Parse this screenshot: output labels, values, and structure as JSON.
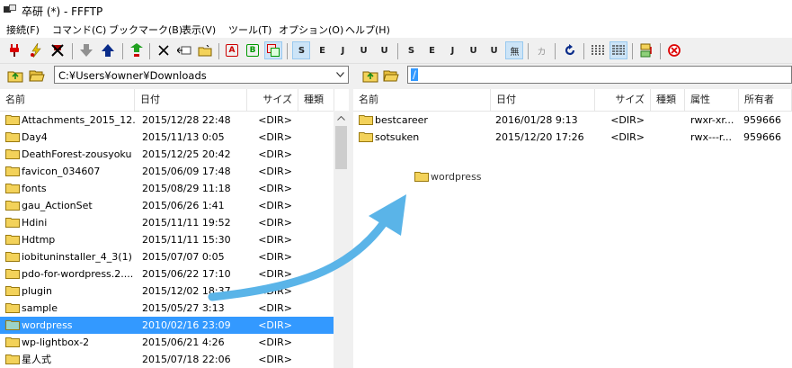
{
  "window": {
    "title": "卒研 (*) - FFFTP"
  },
  "menu": [
    "接続(F)",
    "コマンド(C)",
    "ブックマーク(B)",
    "表示(V)",
    "ツール(T)",
    "オプション(O)",
    "ヘルプ(H)"
  ],
  "toolbar": {
    "ascii_label": "A",
    "binary_label": "B",
    "sjis_label": "S",
    "euc_label": "E",
    "jis_label": "J",
    "utf8_label": "U",
    "utf8bom_label": "U",
    "none_label": "無",
    "kana_label": "カ"
  },
  "local": {
    "path": "C:¥Users¥owner¥Downloads",
    "columns": {
      "name": "名前",
      "date": "日付",
      "size": "サイズ",
      "type": "種類"
    },
    "files": [
      {
        "name": "Attachments_2015_12...",
        "date": "2015/12/28 22:48",
        "size": "<DIR>",
        "selected": false
      },
      {
        "name": "Day4",
        "date": "2015/11/13 0:05",
        "size": "<DIR>",
        "selected": false
      },
      {
        "name": "DeathForest-zousyoku",
        "date": "2015/12/25 20:42",
        "size": "<DIR>",
        "selected": false
      },
      {
        "name": "favicon_034607",
        "date": "2015/06/09 17:48",
        "size": "<DIR>",
        "selected": false
      },
      {
        "name": "fonts",
        "date": "2015/08/29 11:18",
        "size": "<DIR>",
        "selected": false
      },
      {
        "name": "gau_ActionSet",
        "date": "2015/06/26 1:41",
        "size": "<DIR>",
        "selected": false
      },
      {
        "name": "Hdini",
        "date": "2015/11/11 19:52",
        "size": "<DIR>",
        "selected": false
      },
      {
        "name": "Hdtmp",
        "date": "2015/11/11 15:30",
        "size": "<DIR>",
        "selected": false
      },
      {
        "name": "iobituninstaller_4_3(1)",
        "date": "2015/07/07 0:05",
        "size": "<DIR>",
        "selected": false
      },
      {
        "name": "pdo-for-wordpress.2....",
        "date": "2015/06/22 17:10",
        "size": "<DIR>",
        "selected": false
      },
      {
        "name": "plugin",
        "date": "2015/12/02 18:37",
        "size": "<DIR>",
        "selected": false
      },
      {
        "name": "sample",
        "date": "2015/05/27 3:13",
        "size": "<DIR>",
        "selected": false
      },
      {
        "name": "wordpress",
        "date": "2010/02/16 23:09",
        "size": "<DIR>",
        "selected": true
      },
      {
        "name": "wp-lightbox-2",
        "date": "2015/06/21 4:26",
        "size": "<DIR>",
        "selected": false
      },
      {
        "name": "星人式",
        "date": "2015/07/18 22:06",
        "size": "<DIR>",
        "selected": false
      }
    ]
  },
  "remote": {
    "path": "/",
    "columns": {
      "name": "名前",
      "date": "日付",
      "size": "サイズ",
      "type": "種類",
      "attr": "属性",
      "owner": "所有者"
    },
    "files": [
      {
        "name": "bestcareer",
        "date": "2016/01/28 9:13",
        "size": "<DIR>",
        "attr": "rwxr-xr...",
        "owner": "959666"
      },
      {
        "name": "sotsuken",
        "date": "2015/12/20 17:26",
        "size": "<DIR>",
        "attr": "rwx---r...",
        "owner": "959666"
      }
    ],
    "drag_ghost": "wordpress"
  },
  "colors": {
    "selection": "#3399ff",
    "arrow": "#5ab4e8",
    "folder": "#f3d25a"
  }
}
